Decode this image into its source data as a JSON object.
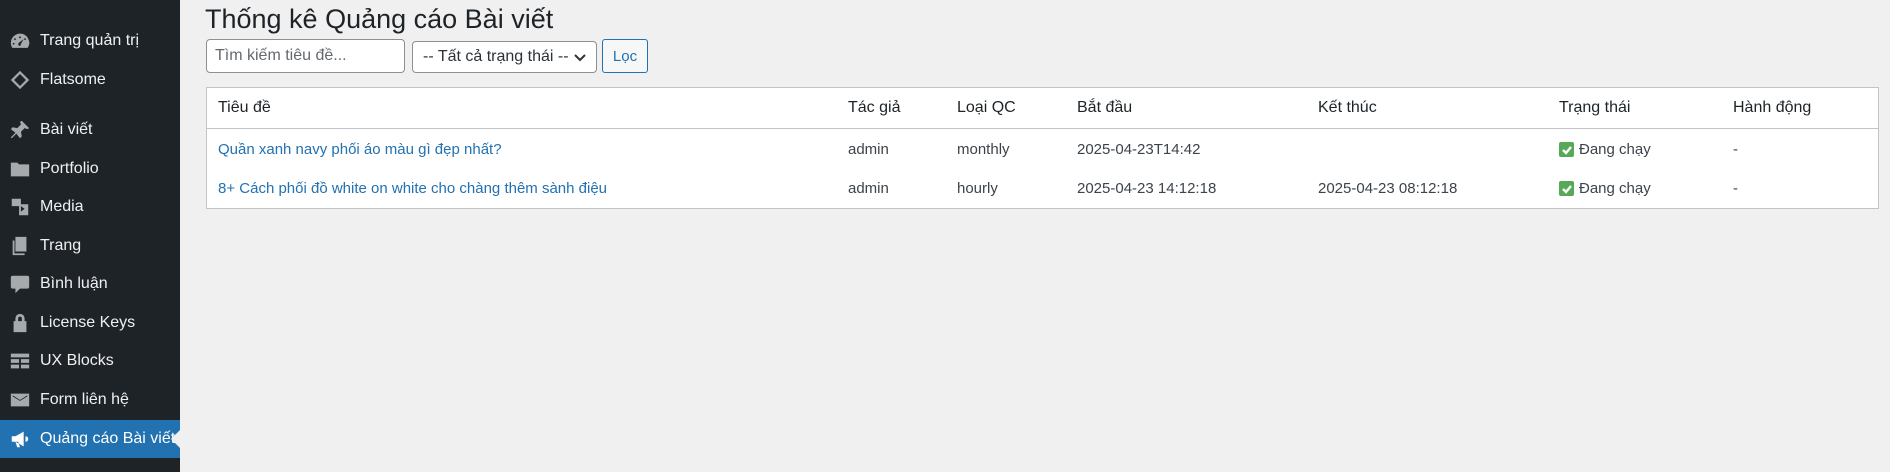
{
  "sidebar": {
    "items": [
      {
        "label": "Trang quản trị",
        "icon": "dashboard-icon"
      },
      {
        "label": "Flatsome",
        "icon": "flatsome-icon"
      },
      {
        "label": "Bài viết",
        "icon": "pin-icon"
      },
      {
        "label": "Portfolio",
        "icon": "folder-icon"
      },
      {
        "label": "Media",
        "icon": "media-icon"
      },
      {
        "label": "Trang",
        "icon": "pages-icon"
      },
      {
        "label": "Bình luận",
        "icon": "comment-icon"
      },
      {
        "label": "License Keys",
        "icon": "lock-icon"
      },
      {
        "label": "UX Blocks",
        "icon": "blocks-icon"
      },
      {
        "label": "Form liên hệ",
        "icon": "mail-icon"
      },
      {
        "label": "Quảng cáo Bài viết",
        "icon": "megaphone-icon",
        "active": true
      }
    ]
  },
  "page": {
    "title": "Thống kê Quảng cáo Bài viết"
  },
  "filters": {
    "search_placeholder": "Tìm kiếm tiêu đề...",
    "search_value": "",
    "status_selected": "-- Tất cả trạng thái --",
    "filter_button": "Lọc"
  },
  "table": {
    "columns": [
      "Tiêu đề",
      "Tác giả",
      "Loại QC",
      "Bắt đầu",
      "Kết thúc",
      "Trạng thái",
      "Hành động"
    ],
    "rows": [
      {
        "title": "Quần xanh navy phối áo màu gì đẹp nhất?",
        "author": "admin",
        "type": "monthly",
        "start": "2025-04-23T14:42",
        "end": "",
        "status": "Đang chạy",
        "action": "-"
      },
      {
        "title": "8+ Cách phối đồ white on white cho chàng thêm sành điệu",
        "author": "admin",
        "type": "hourly",
        "start": "2025-04-23 14:12:18",
        "end": "2025-04-23 08:12:18",
        "status": "Đang chạy",
        "action": "-"
      }
    ]
  },
  "colors": {
    "sidebar_bg": "#1d2327",
    "accent": "#2271b1",
    "link": "#2271b1",
    "status_check": "#57a957",
    "page_bg": "#f0f0f1"
  }
}
